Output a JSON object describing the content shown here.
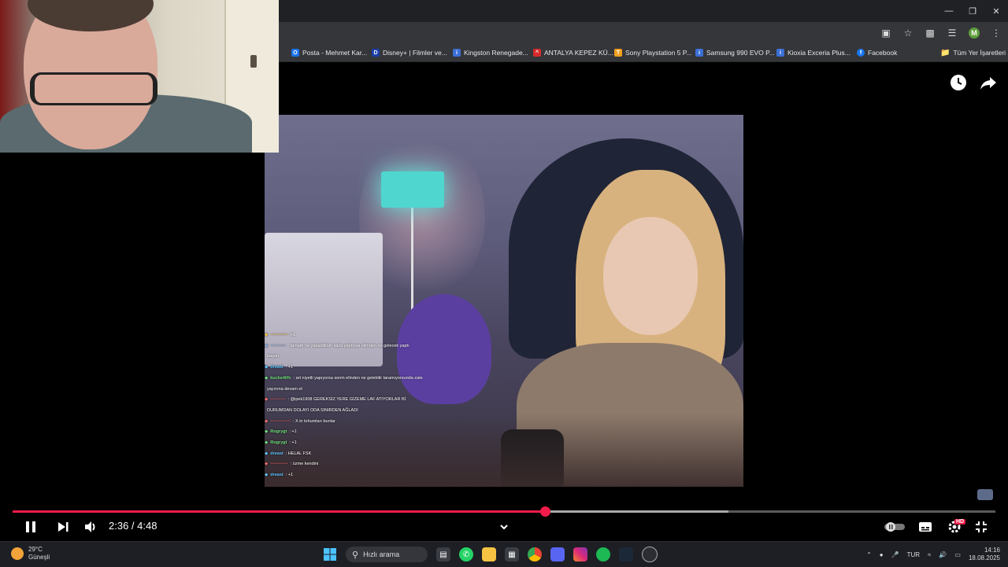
{
  "browser": {
    "bookmarks": [
      {
        "label": "Posta - Mehmet Kar...",
        "icon": "outlook-icon",
        "color": "#1a73e8"
      },
      {
        "label": "Disney+ | Filmler ve...",
        "icon": "disney-icon",
        "color": "#1b3fa8"
      },
      {
        "label": "Kingston Renegade...",
        "icon": "ih-icon",
        "color": "#3c6fd6"
      },
      {
        "label": "ANTALYA KEPEZ KÜ...",
        "icon": "ak-icon",
        "color": "#d62b2b"
      },
      {
        "label": "Sony Playstation 5 P...",
        "icon": "shop-icon",
        "color": "#f0a020"
      },
      {
        "label": "Samsung 990 EVO P...",
        "icon": "ih-icon",
        "color": "#3c6fd6"
      },
      {
        "label": "Kioxia Exceria Plus...",
        "icon": "ih-icon",
        "color": "#3c6fd6"
      },
      {
        "label": "Facebook",
        "icon": "facebook-icon",
        "color": "#1877f2"
      }
    ],
    "all_bookmarks": "Tüm Yer İşaretleri",
    "profile_initial": "M"
  },
  "chat": [
    {
      "user": "~~~~~~~",
      "msg": "HL",
      "color": "#f5c542"
    },
    {
      "user": "~~~~~~",
      "msg": ": tamam ne yapabilirsin kaza yaptıysa elimden ne gelecek yaptı",
      "color": "#8ad"
    },
    {
      "user": "",
      "msg": "başarı",
      "color": "#fff"
    },
    {
      "user": "dreast",
      "msg": ": +1",
      "color": "#5ec6ff"
    },
    {
      "user": "",
      "msg": "",
      "color": "#fff"
    },
    {
      "user": "kucke40fz",
      "msg": ": art niyetli yapıyorsa senin elinden ne gelebilir taramıyorsunda zate",
      "color": "#6ee07a"
    },
    {
      "user": "",
      "msg": "yayınına devam et",
      "color": "#fff"
    },
    {
      "user": "~~~~~~",
      "msg": ": @ipek1908 GEREKSİZ YERE GİZEME LAF ATIYORLAR Bİ",
      "color": "#ff6b6b"
    },
    {
      "user": "",
      "msg": "DURUMDAN DOLAYI ODA SINIRDEN AĞLADI",
      "color": "#fff"
    },
    {
      "user": "~~~~~~~~",
      "msg": ": X in tohumları bunlar",
      "color": "#ff6b6b"
    },
    {
      "user": "Rogrygt",
      "msg": ": +1",
      "color": "#6ee07a"
    },
    {
      "user": "Rogrygt",
      "msg": ": +1",
      "color": "#6ee07a"
    },
    {
      "user": "dreast",
      "msg": ": HELAL FSK",
      "color": "#5ec6ff"
    },
    {
      "user": "~~~~~~~",
      "msg": ": üzme kendini",
      "color": "#ff6b6b"
    },
    {
      "user": "dreast",
      "msg": ": +1",
      "color": "#5ec6ff"
    }
  ],
  "player": {
    "current_time": "2:36",
    "separator": " / ",
    "duration": "4:48",
    "played_fraction": 0.542,
    "buffered_fraction": 0.728,
    "accent": "#f21c4a",
    "hd_badge": "HD"
  },
  "taskbar": {
    "temperature": "29°C",
    "weather": "Güneşli",
    "search_placeholder": "Hızlı arama",
    "language": "TUR",
    "time": "14:16",
    "date": "18.08.2025"
  }
}
